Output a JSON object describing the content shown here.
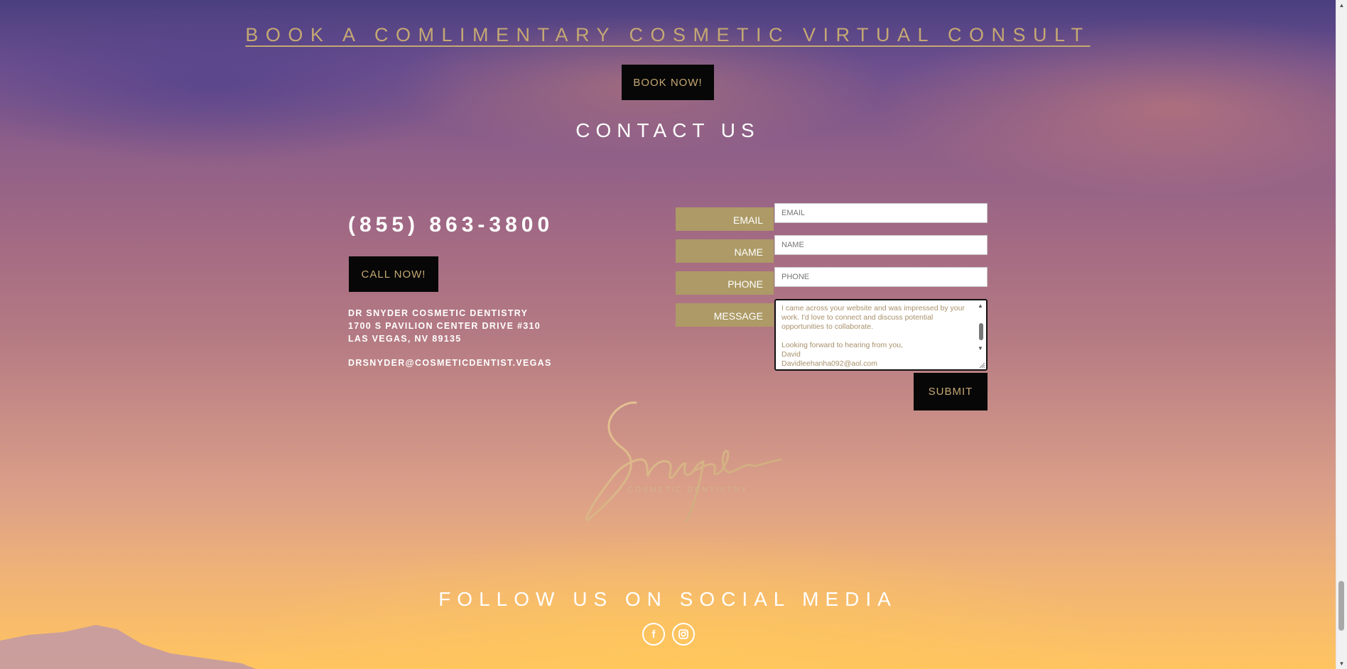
{
  "hero": {
    "book_title": "BOOK A COMLIMENTARY COSMETIC VIRTUAL CONSULT",
    "book_button": "BOOK NOW!"
  },
  "contact": {
    "title": "CONTACT US",
    "phone": "(855) 863-3800",
    "call_button": "CALL NOW!",
    "address_lines": [
      "DR SNYDER COSMETIC DENTISTRY",
      "1700 S PAVILION CENTER DRIVE #310",
      "LAS VEGAS, NV 89135"
    ],
    "email": "DRSNYDER@COSMETICDENTIST.VEGAS"
  },
  "form": {
    "email_label": "EMAIL",
    "email_placeholder": "EMAIL",
    "name_label": "NAME",
    "name_placeholder": "NAME",
    "phone_label": "PHONE",
    "phone_placeholder": "PHONE",
    "message_label": "MESSAGE",
    "message_value": "I came across your website and was impressed by your work. I'd love to connect and discuss potential opportunities to collaborate.\n\nLooking forward to hearing from you,\nDavid\nDavidleehanha092@aol.com",
    "submit_label": "SUBMIT"
  },
  "logo": {
    "script_text": "Snyder",
    "subtitle": "COSMETIC DENTISTRY"
  },
  "social": {
    "title": "FOLLOW US ON SOCIAL MEDIA",
    "facebook_icon": "facebook-icon",
    "instagram_icon": "instagram-icon"
  },
  "colors": {
    "gold": "#c5a873",
    "label_gold": "#ad9a66",
    "button_black": "#070707",
    "white": "#ffffff"
  }
}
